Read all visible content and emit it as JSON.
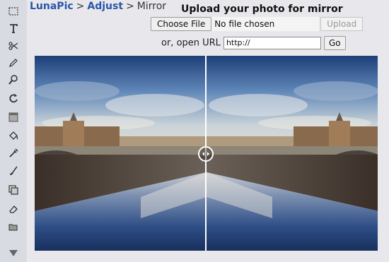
{
  "breadcrumb": {
    "site": "LunaPic",
    "section": "Adjust",
    "page": "Mirror",
    "separator": ">"
  },
  "upload": {
    "title": "Upload your photo for mirror",
    "choose_file_label": "Choose File",
    "no_file_text": "No file chosen",
    "upload_label": "Upload"
  },
  "url": {
    "label": "or, open URL",
    "value": "http://",
    "go_label": "Go"
  },
  "toolbar": {
    "icons": [
      "marquee-select-icon",
      "text-icon",
      "scissors-icon",
      "pencil-icon",
      "zoom-icon",
      "rotate-icon",
      "gradient-icon",
      "paint-bucket-icon",
      "eyedropper-icon",
      "brush-icon",
      "layers-icon",
      "eraser-icon",
      "open-folder-icon",
      "scroll-down-icon"
    ]
  }
}
